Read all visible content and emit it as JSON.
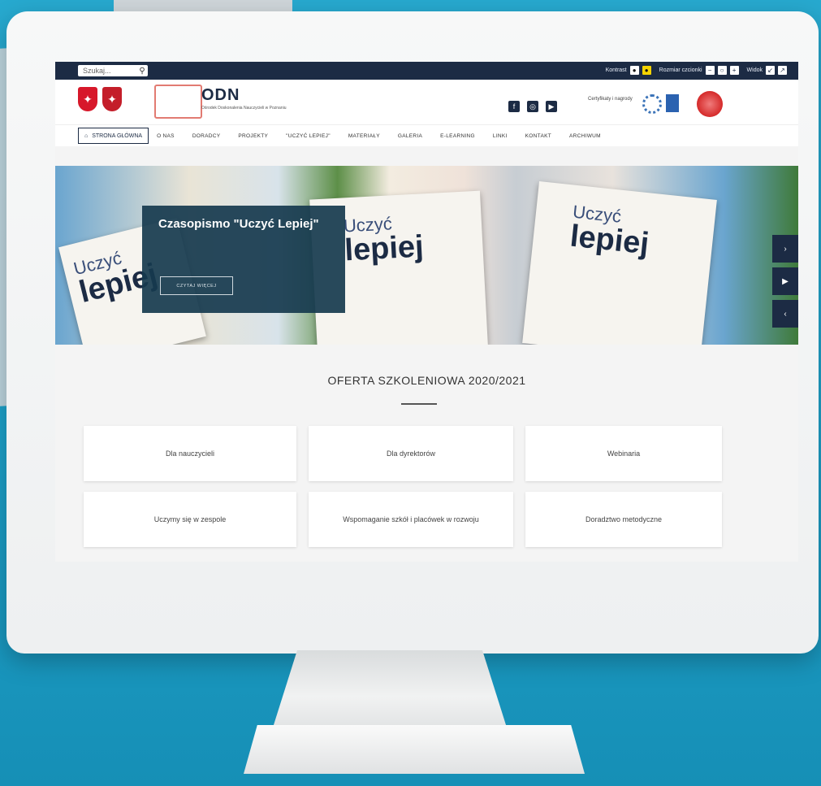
{
  "topbar": {
    "search_placeholder": "Szukaj...",
    "contrast_label": "Kontrast",
    "font_size_label": "Rozmiar czcionki",
    "width_label": "Widok"
  },
  "header": {
    "brand": "ODN",
    "brand_subtitle": "Ośrodek Doskonalenia Nauczycieli w Poznaniu",
    "certs_label": "Certyfikaty i nagrody"
  },
  "nav": {
    "home": "STRONA GŁÓWNA",
    "items": [
      "O NAS",
      "DORADCY",
      "PROJEKTY",
      "\"UCZYĆ LEPIEJ\"",
      "MATERIAŁY",
      "GALERIA",
      "E-LEARNING",
      "LINKI",
      "KONTAKT",
      "ARCHIWUM"
    ]
  },
  "hero": {
    "title": "Czasopismo \"Uczyć Lepiej\"",
    "button": "CZYTAJ WIĘCEJ",
    "mag_word1": "Uczyć",
    "mag_word2": "lepiej"
  },
  "offer": {
    "title": "OFERTA SZKOLENIOWA 2020/2021",
    "cards": [
      "Dla nauczycieli",
      "Dla dyrektorów",
      "Webinaria",
      "Uczymy się w zespole",
      "Wspomaganie szkół i placówek w rozwoju",
      "Doradztwo metodyczne"
    ]
  },
  "colors": {
    "navy": "#1c2b44",
    "wall": "#1da0c8",
    "overlay": "#163a4e"
  }
}
